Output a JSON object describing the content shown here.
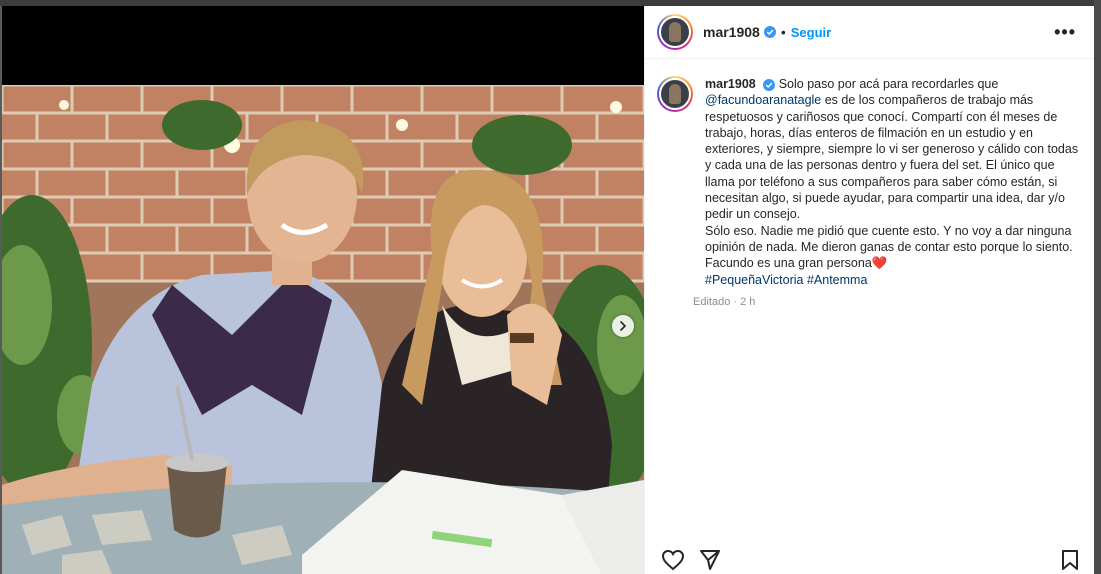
{
  "post": {
    "username": "mar1908",
    "follow_label": "Seguir",
    "more_label": "•••",
    "caption": {
      "username": "mar1908",
      "lines": [
        "Solo paso por acá para recordarles que",
        "@facundoaranatagle",
        "es de los compañeros de trabajo más respetuosos y cariñosos que conocí. Compartí con él meses de trabajo, horas, días enteros de filmación en un estudio y en exteriores, y siempre, siempre lo vi ser generoso y cálido con todas y cada una de las personas dentro y fuera del set. El único que llama por teléfono a sus compañeros para saber cómo están, si necesitan algo, si puede ayudar, para compartir una idea, dar y/o pedir un consejo.",
        "Sólo eso. Nadie me pidió que cuente esto. Y no voy a dar ninguna opinión de nada. Me dieron ganas de contar esto porque lo siento. Facundo es una gran persona❤️",
        "#PequeñaVictoria #Antemma"
      ],
      "hashtags": [
        "#PequeñaVictoria",
        "#Antemma"
      ],
      "edited_label": "Editado",
      "time": "2 h"
    }
  },
  "colors": {
    "link": "#00376b",
    "follow": "#0095f6",
    "verified": "#3897f0",
    "text": "#262626",
    "muted": "#8e8e8e"
  },
  "icons": {
    "verified": "verified-badge-icon",
    "next": "chevron-right-icon",
    "like": "heart-icon",
    "share": "paper-plane-icon",
    "save": "bookmark-icon",
    "more": "ellipsis-icon"
  }
}
